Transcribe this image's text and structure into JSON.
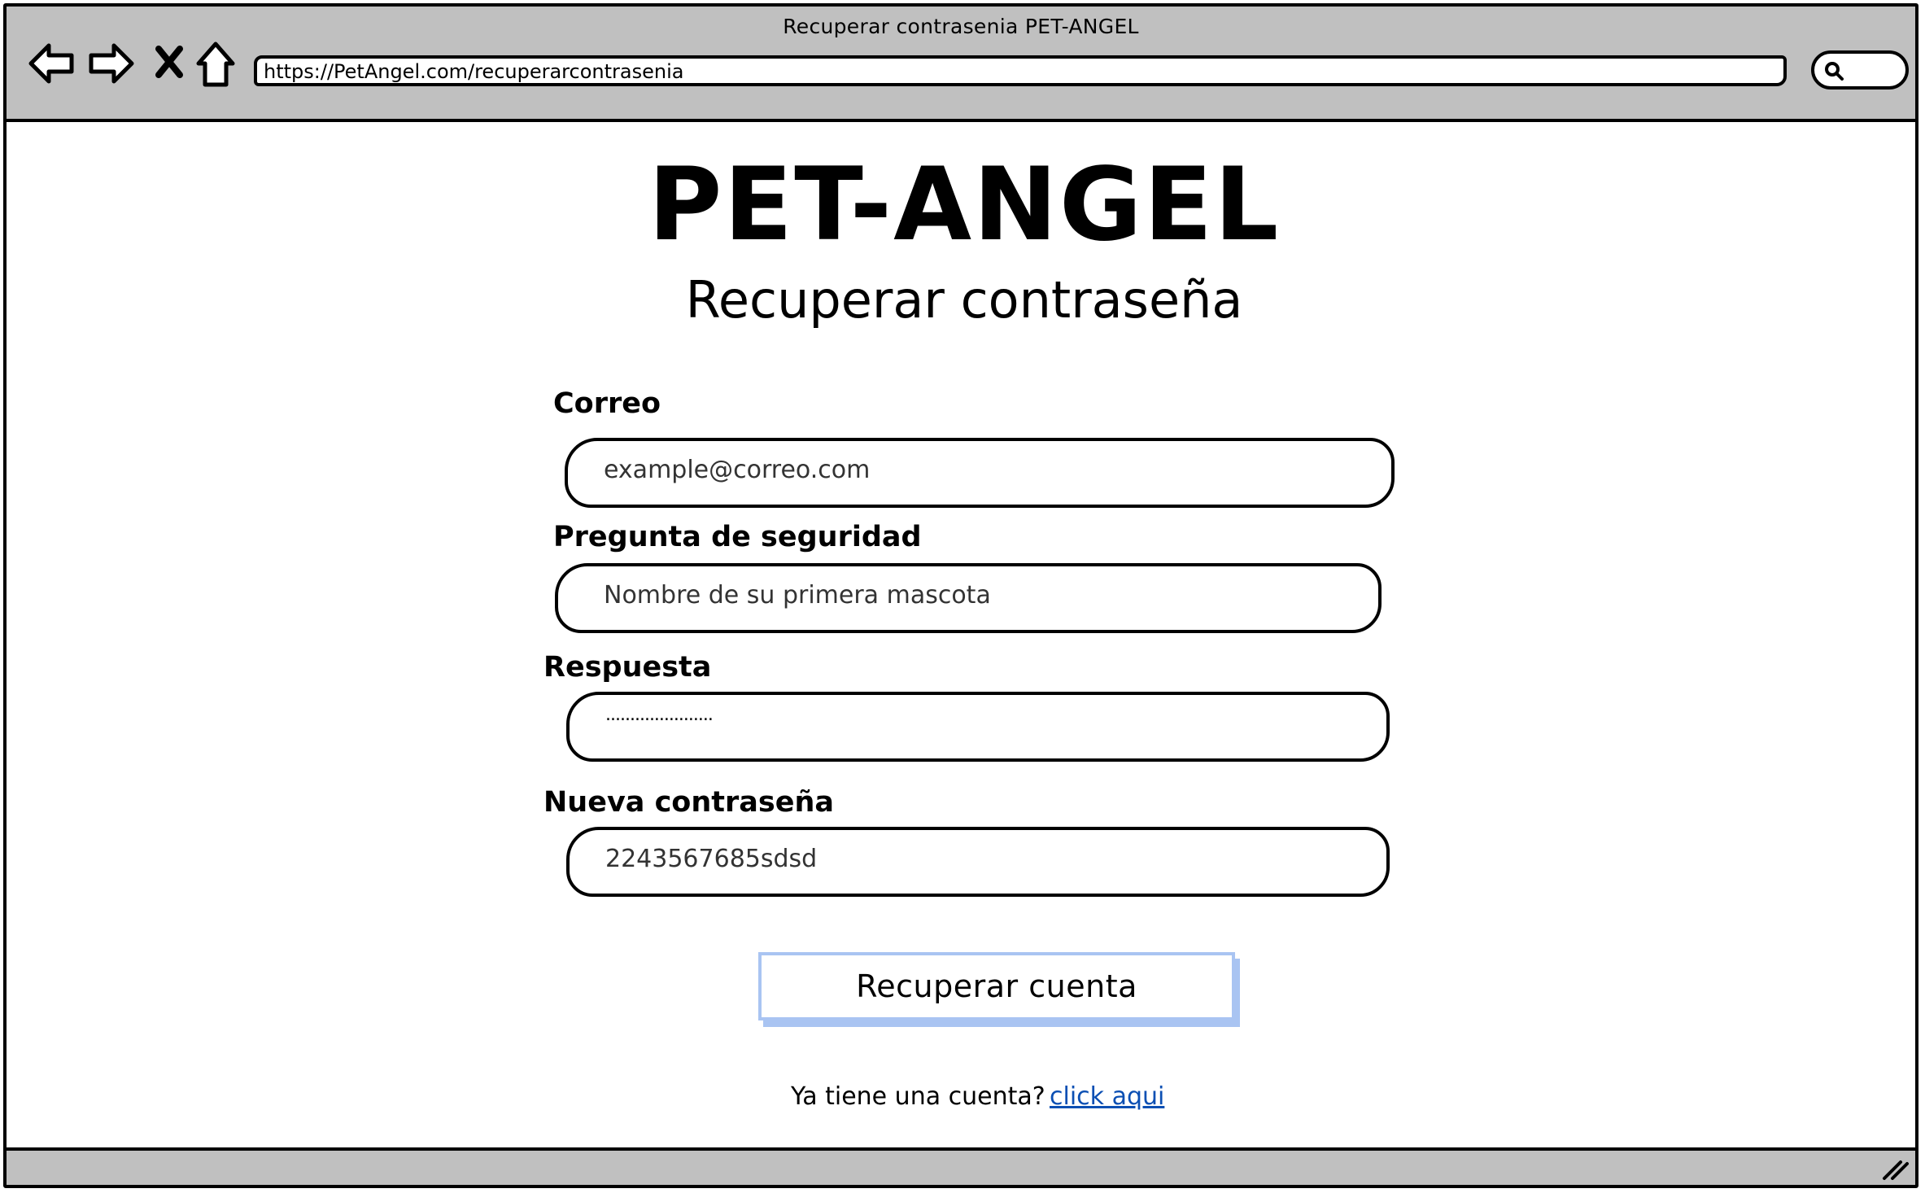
{
  "browser": {
    "window_title": "Recuperar contrasenia PET-ANGEL",
    "url": "https://PetAngel.com/recuperarcontrasenia",
    "icons": [
      "back-arrow-icon",
      "forward-arrow-icon",
      "stop-icon",
      "home-icon",
      "search-icon",
      "resize-grip-icon"
    ]
  },
  "page": {
    "logo": "PET-ANGEL",
    "subtitle": "Recuperar contraseña"
  },
  "form": {
    "email": {
      "label": "Correo",
      "placeholder": "example@correo.com"
    },
    "question": {
      "label": "Pregunta de seguridad",
      "value": "Nombre de su primera mascota"
    },
    "answer": {
      "label": "Respuesta",
      "value": "......................"
    },
    "new_password": {
      "label": "Nueva contraseña",
      "value": "2243567685sdsd"
    },
    "submit_label": "Recuperar cuenta"
  },
  "footer": {
    "prompt": "Ya tiene una cuenta?",
    "link": "click aqui"
  },
  "colors": {
    "chrome": "#c0c0c0",
    "button_border": "#a9c4f2",
    "link": "#0b4fb3"
  }
}
